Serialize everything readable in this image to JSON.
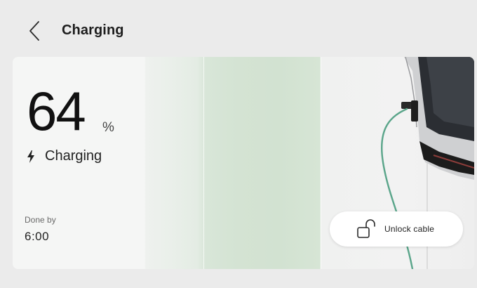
{
  "header": {
    "back_icon": "chevron-left-icon",
    "title": "Charging"
  },
  "battery": {
    "level": "64",
    "unit": "%",
    "level_fraction": 0.64
  },
  "status": {
    "icon": "lightning-bolt-icon",
    "label": "Charging"
  },
  "schedule": {
    "done_label": "Done by",
    "done_time": "6:00"
  },
  "cable": {
    "icon": "unlock-icon",
    "label": "Unlock cable"
  },
  "colors": {
    "background": "#ebebeb",
    "card": "#f5f5f5",
    "charge_band": "#d4e3d3",
    "cable": "#5aa58a",
    "text": "#1d1d1d"
  }
}
